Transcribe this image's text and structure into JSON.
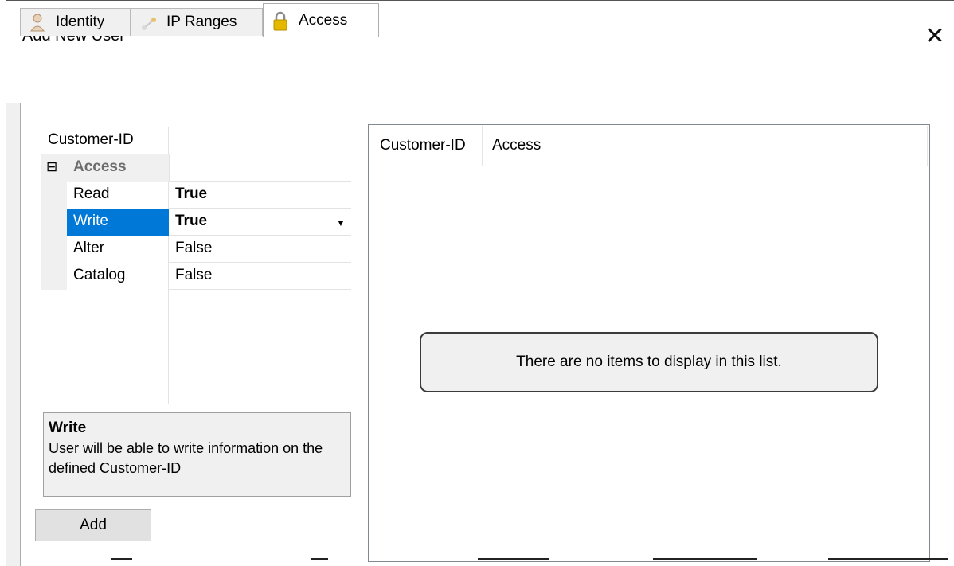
{
  "window": {
    "title": "Add New User"
  },
  "tabs": [
    {
      "label": "Identity",
      "icon": "user-icon"
    },
    {
      "label": "IP Ranges",
      "icon": "network-icon"
    },
    {
      "label": "Access",
      "icon": "lock-icon"
    }
  ],
  "active_tab": "Access",
  "property_grid": {
    "rows": [
      {
        "name": "Customer-ID",
        "value": ""
      },
      {
        "category": "Access",
        "toggle": "⊟"
      },
      {
        "name": "Read",
        "value": "True"
      },
      {
        "name": "Write",
        "value": "True"
      },
      {
        "name": "Alter",
        "value": "False"
      },
      {
        "name": "Catalog",
        "value": "False"
      }
    ]
  },
  "description": {
    "title": "Write",
    "body": "User will be able to write information on the defined Customer-ID"
  },
  "add_button_label": "Add",
  "list": {
    "columns": [
      "Customer-ID",
      "Access"
    ],
    "empty_message": "There are no items to display in this list."
  },
  "colors": {
    "selection": "#0078d7",
    "panel": "#f0f0f0"
  }
}
